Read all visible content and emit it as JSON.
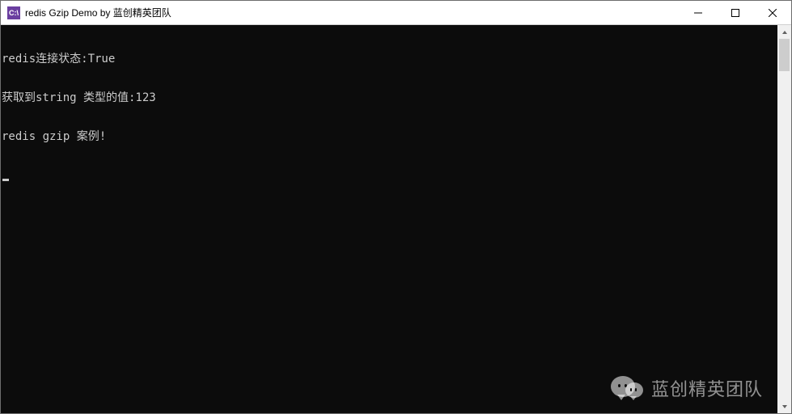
{
  "window": {
    "icon_label": "C:\\",
    "title": "redis Gzip Demo by 蓝创精英团队"
  },
  "titlebar_controls": {
    "minimize": "Minimize",
    "maximize": "Maximize",
    "close": "Close"
  },
  "console": {
    "lines": [
      "redis连接状态:True",
      "获取到string 类型的值:123",
      "redis gzip 案例!"
    ]
  },
  "scrollbar": {
    "up": "Scroll up",
    "down": "Scroll down"
  },
  "watermark": {
    "text": "蓝创精英团队"
  }
}
